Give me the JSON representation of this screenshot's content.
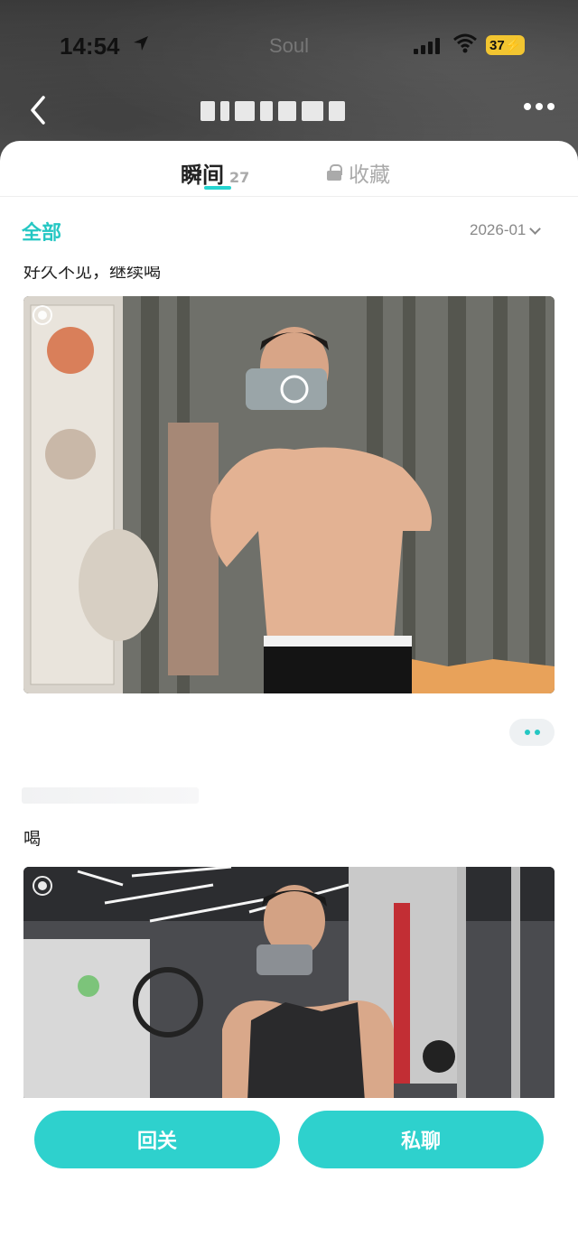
{
  "status_bar": {
    "time": "14:54",
    "app_label": "Soul",
    "battery": "37"
  },
  "tabs": {
    "moments_label": "瞬间",
    "moments_count": "27",
    "favorites_label": "收藏"
  },
  "filter": {
    "all_label": "全部",
    "date_value": "2026-01"
  },
  "posts": [
    {
      "text": "好久不见，继续喝"
    },
    {
      "text": "喝"
    }
  ],
  "actions": {
    "follow_back_label": "回关",
    "private_chat_label": "私聊"
  },
  "colors": {
    "accent": "#2ed1cd",
    "accent_text": "#25c7c3"
  },
  "icons": [
    "back-chevron-icon",
    "more-icon",
    "lock-icon",
    "chevron-down-icon",
    "live-photo-icon",
    "location-arrow-icon",
    "wifi-icon",
    "signal-icon"
  ]
}
